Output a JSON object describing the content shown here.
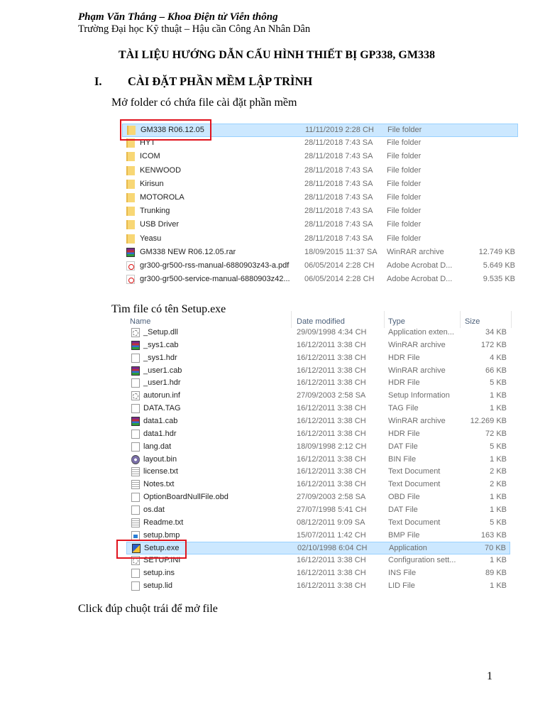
{
  "header": {
    "author": "Phạm Văn Thắng – Khoa Điện tử Viễn thông",
    "school": "Trường Đại học Kỹ thuật – Hậu cần Công An Nhân Dân"
  },
  "document_title": "TÀI LIỆU HƯỚNG DẪN CẤU HÌNH THIẾT BỊ GP338, GM338",
  "section": {
    "number": "I.",
    "title": "CÀI ĐẶT PHẦN MỀM LẬP TRÌNH"
  },
  "steps": {
    "open_folder": "Mở folder có chứa file cài đặt phần mềm",
    "find_file": "Tìm file có tên Setup.exe",
    "double_click": "Click đúp chuột trái để mở file"
  },
  "folder_list": [
    {
      "icon": "folder-icon",
      "name": "GM338  R06.12.05",
      "date": "11/11/2019 2:28 CH",
      "type": "File folder",
      "size": "",
      "selected": true
    },
    {
      "icon": "folder-icon",
      "name": "HYT",
      "date": "28/11/2018 7:43 SA",
      "type": "File folder",
      "size": ""
    },
    {
      "icon": "folder-icon",
      "name": "ICOM",
      "date": "28/11/2018 7:43 SA",
      "type": "File folder",
      "size": ""
    },
    {
      "icon": "folder-icon",
      "name": "KENWOOD",
      "date": "28/11/2018 7:43 SA",
      "type": "File folder",
      "size": ""
    },
    {
      "icon": "folder-icon",
      "name": "Kirisun",
      "date": "28/11/2018 7:43 SA",
      "type": "File folder",
      "size": ""
    },
    {
      "icon": "folder-icon",
      "name": "MOTOROLA",
      "date": "28/11/2018 7:43 SA",
      "type": "File folder",
      "size": ""
    },
    {
      "icon": "folder-icon",
      "name": "Trunking",
      "date": "28/11/2018 7:43 SA",
      "type": "File folder",
      "size": ""
    },
    {
      "icon": "folder-icon",
      "name": "USB Driver",
      "date": "28/11/2018 7:43 SA",
      "type": "File folder",
      "size": ""
    },
    {
      "icon": "folder-icon",
      "name": "Yeasu",
      "date": "28/11/2018 7:43 SA",
      "type": "File folder",
      "size": ""
    },
    {
      "icon": "winrar-icon",
      "name": "GM338 NEW R06.12.05.rar",
      "date": "18/09/2015 11:37 SA",
      "type": "WinRAR archive",
      "size": "12.749 KB"
    },
    {
      "icon": "pdf-icon",
      "name": "gr300-gr500-rss-manual-6880903z43-a.pdf",
      "date": "06/05/2014 2:28 CH",
      "type": "Adobe Acrobat D...",
      "size": "5.649 KB"
    },
    {
      "icon": "pdf-icon",
      "name": "gr300-gr500-service-manual-6880903z42...",
      "date": "06/05/2014 2:28 CH",
      "type": "Adobe Acrobat D...",
      "size": "9.535 KB"
    }
  ],
  "setup_list": {
    "columns": {
      "name": "Name",
      "date": "Date modified",
      "type": "Type",
      "size": "Size"
    },
    "rows": [
      {
        "icon": "dll-icon",
        "name": "_Setup.dll",
        "date": "29/09/1998 4:34 CH",
        "type": "Application exten...",
        "size": "34 KB"
      },
      {
        "icon": "winrar-icon",
        "name": "_sys1.cab",
        "date": "16/12/2011 3:38 CH",
        "type": "WinRAR archive",
        "size": "172 KB"
      },
      {
        "icon": "file-icon",
        "name": "_sys1.hdr",
        "date": "16/12/2011 3:38 CH",
        "type": "HDR File",
        "size": "4 KB"
      },
      {
        "icon": "winrar-icon",
        "name": "_user1.cab",
        "date": "16/12/2011 3:38 CH",
        "type": "WinRAR archive",
        "size": "66 KB"
      },
      {
        "icon": "file-icon",
        "name": "_user1.hdr",
        "date": "16/12/2011 3:38 CH",
        "type": "HDR File",
        "size": "5 KB"
      },
      {
        "icon": "settings-file-icon",
        "name": "autorun.inf",
        "date": "27/09/2003 2:58 SA",
        "type": "Setup Information",
        "size": "1 KB"
      },
      {
        "icon": "file-icon",
        "name": "DATA.TAG",
        "date": "16/12/2011 3:38 CH",
        "type": "TAG File",
        "size": "1 KB"
      },
      {
        "icon": "winrar-icon",
        "name": "data1.cab",
        "date": "16/12/2011 3:38 CH",
        "type": "WinRAR archive",
        "size": "12.269 KB"
      },
      {
        "icon": "file-icon",
        "name": "data1.hdr",
        "date": "16/12/2011 3:38 CH",
        "type": "HDR File",
        "size": "72 KB"
      },
      {
        "icon": "file-icon",
        "name": "lang.dat",
        "date": "18/09/1998 2:12 CH",
        "type": "DAT File",
        "size": "5 KB"
      },
      {
        "icon": "disc-icon",
        "name": "layout.bin",
        "date": "16/12/2011 3:38 CH",
        "type": "BIN File",
        "size": "1 KB"
      },
      {
        "icon": "text-file-icon",
        "name": "license.txt",
        "date": "16/12/2011 3:38 CH",
        "type": "Text Document",
        "size": "2 KB"
      },
      {
        "icon": "text-file-icon",
        "name": "Notes.txt",
        "date": "16/12/2011 3:38 CH",
        "type": "Text Document",
        "size": "2 KB"
      },
      {
        "icon": "file-icon",
        "name": "OptionBoardNullFile.obd",
        "date": "27/09/2003 2:58 SA",
        "type": "OBD File",
        "size": "1 KB"
      },
      {
        "icon": "file-icon",
        "name": "os.dat",
        "date": "27/07/1998 5:41 CH",
        "type": "DAT File",
        "size": "1 KB"
      },
      {
        "icon": "text-file-icon",
        "name": "Readme.txt",
        "date": "08/12/2011 9:09 SA",
        "type": "Text Document",
        "size": "5 KB"
      },
      {
        "icon": "bitmap-icon",
        "name": "setup.bmp",
        "date": "15/07/2011 1:42 CH",
        "type": "BMP File",
        "size": "163 KB"
      },
      {
        "icon": "setup-exe-icon",
        "name": "Setup.exe",
        "date": "02/10/1998 6:04 CH",
        "type": "Application",
        "size": "70 KB",
        "selected": true
      },
      {
        "icon": "settings-file-icon",
        "name": "SETUP.INI",
        "date": "16/12/2011 3:38 CH",
        "type": "Configuration sett...",
        "size": "1 KB"
      },
      {
        "icon": "file-icon",
        "name": "setup.ins",
        "date": "16/12/2011 3:38 CH",
        "type": "INS File",
        "size": "89 KB"
      },
      {
        "icon": "file-icon",
        "name": "setup.lid",
        "date": "16/12/2011 3:38 CH",
        "type": "LID File",
        "size": "1 KB"
      }
    ]
  },
  "page_number": "1",
  "colors": {
    "selection": "#cce8ff",
    "selection_border": "#99d1ff",
    "highlight_box": "#e0141e"
  }
}
